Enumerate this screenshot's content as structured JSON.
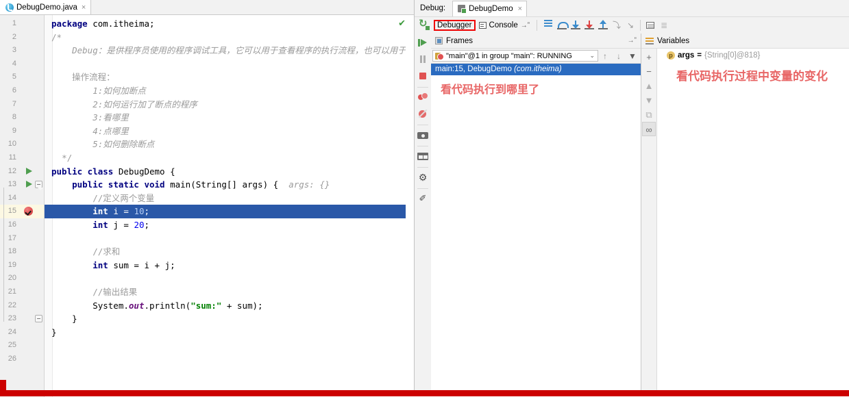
{
  "editor": {
    "tab": {
      "label": "DebugDemo.java",
      "close": "×",
      "icon": "java-class-icon"
    },
    "inspection_ok": "✔",
    "lines": [
      {
        "n": "1",
        "html": "<span class=\"kw\">package</span> com.itheima;"
      },
      {
        "n": "2",
        "html": "<span class=\"cmt\">/*</span>"
      },
      {
        "n": "3",
        "html": "    <span class=\"cmt-i\">Debug：是供程序员使用的程序调试工具，它可以用于查看程序的执行流程，也可以用于</span>"
      },
      {
        "n": "4",
        "html": ""
      },
      {
        "n": "5",
        "html": "    <span class=\"cmt\">操作流程：</span>"
      },
      {
        "n": "6",
        "html": "        <span class=\"cmt-i\">1:如何加断点</span>"
      },
      {
        "n": "7",
        "html": "        <span class=\"cmt-i\">2:如何运行加了断点的程序</span>"
      },
      {
        "n": "8",
        "html": "        <span class=\"cmt-i\">3:看哪里</span>"
      },
      {
        "n": "9",
        "html": "        <span class=\"cmt-i\">4:点哪里</span>"
      },
      {
        "n": "10",
        "html": "        <span class=\"cmt-i\">5:如何删除断点</span>"
      },
      {
        "n": "11",
        "html": "  <span class=\"cmt\">*/</span>"
      },
      {
        "n": "12",
        "html": "<span class=\"kw\">public class</span> DebugDemo {"
      },
      {
        "n": "13",
        "html": "    <span class=\"kw\">public static void</span> main(String[] args) {  <span class=\"hint\">args:</span> <span class=\"hint\">{}</span>"
      },
      {
        "n": "14",
        "html": "        <span class=\"cmt\">//定义两个变量</span>"
      },
      {
        "n": "15",
        "html": "        <span class=\"kw\">int</span> i = <span class=\"num\">10</span>;"
      },
      {
        "n": "16",
        "html": "        <span class=\"kw\">int</span> j = <span class=\"num\">20</span>;"
      },
      {
        "n": "17",
        "html": ""
      },
      {
        "n": "18",
        "html": "        <span class=\"cmt\">//求和</span>"
      },
      {
        "n": "19",
        "html": "        <span class=\"kw\">int</span> sum = i + j;"
      },
      {
        "n": "20",
        "html": ""
      },
      {
        "n": "21",
        "html": "        <span class=\"cmt\">//输出结果</span>"
      },
      {
        "n": "22",
        "html": "        System.<span class=\"fld\">out</span>.println(<span class=\"str\">\"sum:\"</span> + sum);"
      },
      {
        "n": "23",
        "html": "    }"
      },
      {
        "n": "24",
        "html": "}"
      },
      {
        "n": "25",
        "html": ""
      },
      {
        "n": "26",
        "html": ""
      }
    ],
    "selected_line": 15,
    "breakpoint_line": 15,
    "run_arrow_lines": [
      12,
      13
    ]
  },
  "debug": {
    "window_label": "Debug:",
    "session_tab": "DebugDemo",
    "session_tab_close": "×",
    "toolbar": {
      "rerun": "rerun-icon",
      "debugger_tab": "Debugger",
      "console_tab": "Console",
      "console_pin": "→ˮ",
      "highlight_color": "#ee0000",
      "icons": [
        {
          "name": "show-execution-point-icon",
          "cls": "ico-exec"
        },
        {
          "name": "step-over-icon",
          "cls": "ico-stepover"
        },
        {
          "name": "step-into-icon",
          "cls": "ico-stepinto"
        },
        {
          "name": "force-step-into-icon",
          "cls": "ico-force"
        },
        {
          "name": "step-out-icon",
          "cls": "ico-stepout"
        },
        {
          "name": "drop-frame-icon",
          "cls": "ico-grey",
          "glyph": "⤵"
        },
        {
          "name": "run-to-cursor-icon",
          "cls": "ico-grey",
          "glyph": "↘"
        },
        {
          "name": "evaluate-expression-icon",
          "cls": "ico-eval"
        },
        {
          "name": "settings-icon",
          "cls": "ico-settings2",
          "glyph": "≣"
        }
      ]
    },
    "side_buttons": [
      {
        "name": "resume-program-icon",
        "cls": "sb-resume"
      },
      {
        "name": "pause-program-icon",
        "cls": "sb-pause"
      },
      {
        "name": "stop-icon",
        "cls": "sb-stop"
      },
      {
        "name": "view-breakpoints-icon",
        "cls": "sb-bps"
      },
      {
        "name": "mute-breakpoints-icon",
        "cls": "sb-mute"
      },
      {
        "name": "camera-snapshot-icon",
        "cls": "sb-cam"
      },
      {
        "name": "layout-settings-icon",
        "cls": "sb-layout"
      },
      {
        "name": "settings-gear-icon",
        "cls": "sb-gear",
        "glyph": "⚙"
      },
      {
        "name": "pin-tab-icon",
        "cls": "sb-pin",
        "glyph": "✐"
      }
    ],
    "frames": {
      "title": "Frames",
      "hide_glyph": "→ˮ",
      "thread": "\"main\"@1 in group \"main\": RUNNING",
      "caret": "⌄",
      "up": "↑",
      "down": "↓",
      "filter": "▼",
      "rows": [
        {
          "text": "main:15, DebugDemo ",
          "pkg": "(com.itheima)"
        }
      ],
      "annotation": "看代码执行到哪里了"
    },
    "variables": {
      "title": "Variables",
      "side_buttons": [
        {
          "name": "add-watch-icon",
          "glyph": "+"
        },
        {
          "name": "remove-watch-icon",
          "glyph": "−"
        },
        {
          "name": "move-up-icon",
          "glyph": "▲"
        },
        {
          "name": "move-down-icon",
          "glyph": "▼"
        },
        {
          "name": "copy-value-icon",
          "glyph": "⧉"
        },
        {
          "name": "watches-icon",
          "glyph": "∞"
        }
      ],
      "rows": [
        {
          "badge": "p",
          "name": "args",
          "eq": "=",
          "value": "{String[0]@818}"
        }
      ],
      "annotation": "看代码执行过程中变量的变化"
    }
  },
  "colors": {
    "selection_blue": "#2a58a8",
    "frame_selection_blue": "#2a6bc0",
    "annotation_red": "#e86666",
    "highlight_red": "#ee0000",
    "breakpoint_red": "#e05252",
    "bottom_bar_red": "#cc0000"
  }
}
